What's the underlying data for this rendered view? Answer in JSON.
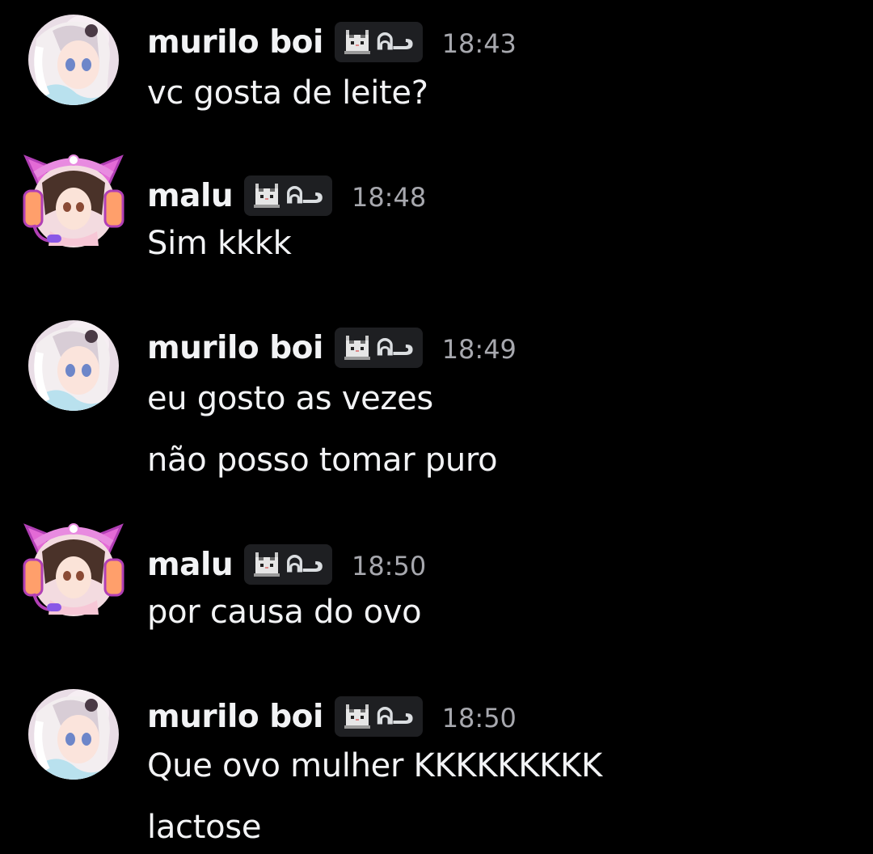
{
  "colors": {
    "background": "#000000",
    "text": "#f2f3f5",
    "timestamp": "#a7a8ae",
    "tag_background": "#1e1f22"
  },
  "tag": {
    "icon": "pixel-cat-icon",
    "text": "ᕱᓗ"
  },
  "messages": [
    {
      "author": "murilo boi",
      "avatar": "anime-girl-avatar-white-hair",
      "time": "18:43",
      "lines": [
        "vc gosta de leite?"
      ]
    },
    {
      "author": "malu",
      "avatar": "anime-girl-avatar-cat-headset",
      "time": "18:48",
      "lines": [
        "Sim kkkk"
      ]
    },
    {
      "author": "murilo boi",
      "avatar": "anime-girl-avatar-white-hair",
      "time": "18:49",
      "lines": [
        "eu gosto as vezes",
        "não posso tomar puro"
      ]
    },
    {
      "author": "malu",
      "avatar": "anime-girl-avatar-cat-headset",
      "time": "18:50",
      "lines": [
        "por causa do ovo"
      ]
    },
    {
      "author": "murilo boi",
      "avatar": "anime-girl-avatar-white-hair",
      "time": "18:50",
      "lines": [
        "Que ovo mulher KKKKKKKKK",
        "lactose"
      ]
    }
  ]
}
